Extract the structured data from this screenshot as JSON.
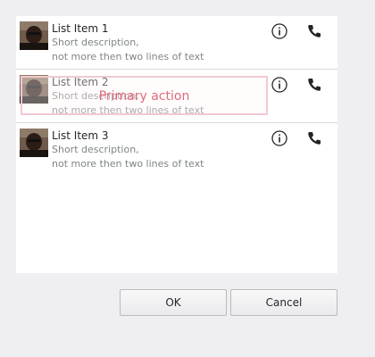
{
  "list": {
    "items": [
      {
        "title": "List Item 1",
        "desc_line1": "Short description,",
        "desc_line2": "not more then two lines of text"
      },
      {
        "title": "List Item 2",
        "desc_line1": "Short description,",
        "desc_line2": "not more then two lines of text"
      },
      {
        "title": "List Item 3",
        "desc_line1": "Short description,",
        "desc_line2": "not more then two lines of text"
      }
    ],
    "info_icon": "info-icon",
    "call_icon": "phone-icon"
  },
  "overlay": {
    "label": "Primary action",
    "color": "#e0697d"
  },
  "buttons": {
    "ok_label": "OK",
    "cancel_label": "Cancel"
  }
}
